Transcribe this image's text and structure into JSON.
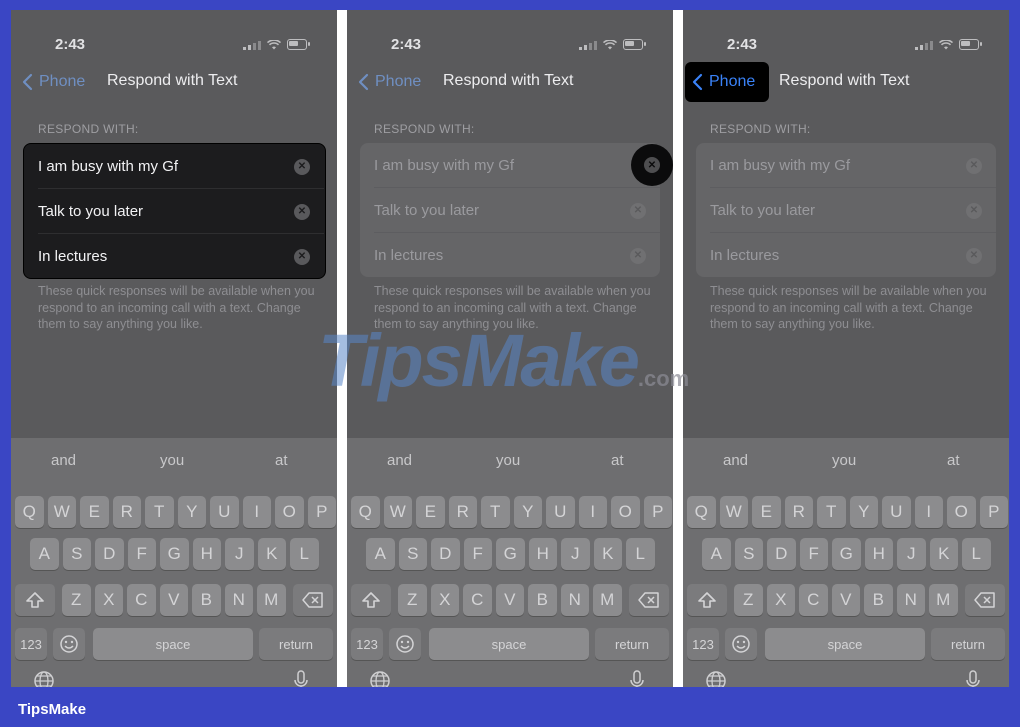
{
  "status": {
    "time": "2:43"
  },
  "nav": {
    "back_label": "Phone",
    "title": "Respond with Text"
  },
  "section_header": "RESPOND WITH:",
  "responses": [
    "I am busy with my Gf",
    "Talk to you later",
    "In lectures"
  ],
  "footer_text": "These quick responses will be available when you respond to an incoming call with a text. Change them to say anything you like.",
  "keyboard": {
    "suggestions": [
      "and",
      "you",
      "at"
    ],
    "row1": [
      "Q",
      "W",
      "E",
      "R",
      "T",
      "Y",
      "U",
      "I",
      "O",
      "P"
    ],
    "row2": [
      "A",
      "S",
      "D",
      "F",
      "G",
      "H",
      "J",
      "K",
      "L"
    ],
    "row3": [
      "Z",
      "X",
      "C",
      "V",
      "B",
      "N",
      "M"
    ],
    "numbers_label": "123",
    "space_label": "space",
    "return_label": "return"
  },
  "watermark": {
    "main": "TipsMake",
    "suffix": ".com"
  },
  "branding": {
    "label": "TipsMake"
  },
  "colors": {
    "accent_blue": "#3a82f7",
    "frame_blue": "#3a46c4"
  }
}
